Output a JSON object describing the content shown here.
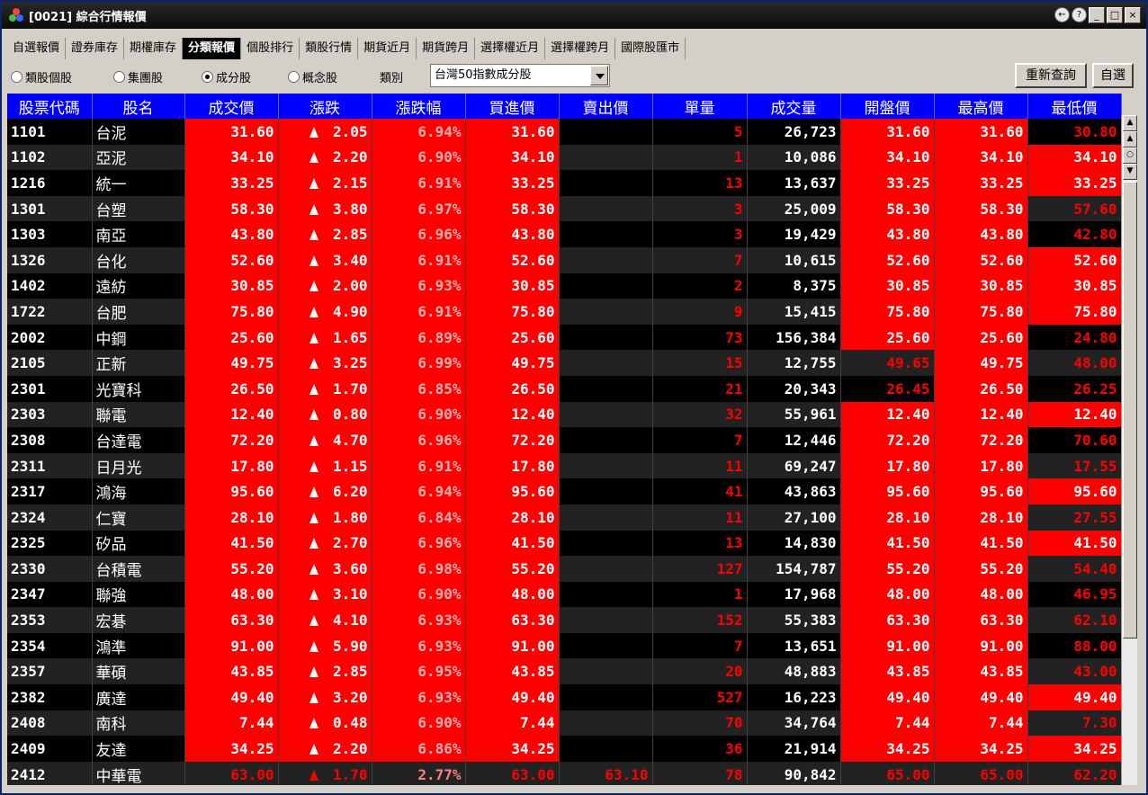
{
  "window": {
    "title": "[0021] 綜合行情報價",
    "help_label": "?",
    "minimize_label": "_",
    "maximize_label": "□",
    "close_label": "×",
    "back_label": "←"
  },
  "tabs": [
    "自選報價",
    "證券庫存",
    "期權庫存",
    "分類報價",
    "個股排行",
    "類股行情",
    "期貨近月",
    "期貨跨月",
    "選擇權近月",
    "選擇權跨月",
    "國際股匯市"
  ],
  "active_tab": "分類報價",
  "toolbar": {
    "radios": [
      "類股個股",
      "集團股",
      "成分股",
      "概念股"
    ],
    "selected_radio": "成分股",
    "category_label": "類別",
    "category_value": "台灣50指數成分股",
    "refresh_label": "重新查詢",
    "watchlist_label": "自選"
  },
  "columns": [
    "股票代碼",
    "股名",
    "成交價",
    "漲跌",
    "漲跌幅",
    "買進價",
    "賣出價",
    "單量",
    "成交量",
    "開盤價",
    "最高價",
    "最低價"
  ],
  "rows": [
    {
      "code": "1101",
      "name": "台泥",
      "price": "31.60",
      "chg": "2.05",
      "pct": "6.94%",
      "bid": "31.60",
      "ask": "",
      "qty": "5",
      "vol": "26,723",
      "open": "31.60",
      "high": "31.60",
      "low": "30.80"
    },
    {
      "code": "1102",
      "name": "亞泥",
      "price": "34.10",
      "chg": "2.20",
      "pct": "6.90%",
      "bid": "34.10",
      "ask": "",
      "qty": "1",
      "vol": "10,086",
      "open": "34.10",
      "high": "34.10",
      "low": "34.10"
    },
    {
      "code": "1216",
      "name": "統一",
      "price": "33.25",
      "chg": "2.15",
      "pct": "6.91%",
      "bid": "33.25",
      "ask": "",
      "qty": "13",
      "vol": "13,637",
      "open": "33.25",
      "high": "33.25",
      "low": "33.25"
    },
    {
      "code": "1301",
      "name": "台塑",
      "price": "58.30",
      "chg": "3.80",
      "pct": "6.97%",
      "bid": "58.30",
      "ask": "",
      "qty": "3",
      "vol": "25,009",
      "open": "58.30",
      "high": "58.30",
      "low": "57.60"
    },
    {
      "code": "1303",
      "name": "南亞",
      "price": "43.80",
      "chg": "2.85",
      "pct": "6.96%",
      "bid": "43.80",
      "ask": "",
      "qty": "3",
      "vol": "19,429",
      "open": "43.80",
      "high": "43.80",
      "low": "42.80"
    },
    {
      "code": "1326",
      "name": "台化",
      "price": "52.60",
      "chg": "3.40",
      "pct": "6.91%",
      "bid": "52.60",
      "ask": "",
      "qty": "7",
      "vol": "10,615",
      "open": "52.60",
      "high": "52.60",
      "low": "52.60"
    },
    {
      "code": "1402",
      "name": "遠紡",
      "price": "30.85",
      "chg": "2.00",
      "pct": "6.93%",
      "bid": "30.85",
      "ask": "",
      "qty": "2",
      "vol": "8,375",
      "open": "30.85",
      "high": "30.85",
      "low": "30.85"
    },
    {
      "code": "1722",
      "name": "台肥",
      "price": "75.80",
      "chg": "4.90",
      "pct": "6.91%",
      "bid": "75.80",
      "ask": "",
      "qty": "9",
      "vol": "15,415",
      "open": "75.80",
      "high": "75.80",
      "low": "75.80"
    },
    {
      "code": "2002",
      "name": "中鋼",
      "price": "25.60",
      "chg": "1.65",
      "pct": "6.89%",
      "bid": "25.60",
      "ask": "",
      "qty": "73",
      "vol": "156,384",
      "open": "25.60",
      "high": "25.60",
      "low": "24.80"
    },
    {
      "code": "2105",
      "name": "正新",
      "price": "49.75",
      "chg": "3.25",
      "pct": "6.99%",
      "bid": "49.75",
      "ask": "",
      "qty": "15",
      "vol": "12,755",
      "open": "49.65",
      "high": "49.75",
      "low": "48.00"
    },
    {
      "code": "2301",
      "name": "光寶科",
      "price": "26.50",
      "chg": "1.70",
      "pct": "6.85%",
      "bid": "26.50",
      "ask": "",
      "qty": "21",
      "vol": "20,343",
      "open": "26.45",
      "high": "26.50",
      "low": "26.25"
    },
    {
      "code": "2303",
      "name": "聯電",
      "price": "12.40",
      "chg": "0.80",
      "pct": "6.90%",
      "bid": "12.40",
      "ask": "",
      "qty": "32",
      "vol": "55,961",
      "open": "12.40",
      "high": "12.40",
      "low": "12.40"
    },
    {
      "code": "2308",
      "name": "台達電",
      "price": "72.20",
      "chg": "4.70",
      "pct": "6.96%",
      "bid": "72.20",
      "ask": "",
      "qty": "7",
      "vol": "12,446",
      "open": "72.20",
      "high": "72.20",
      "low": "70.60"
    },
    {
      "code": "2311",
      "name": "日月光",
      "price": "17.80",
      "chg": "1.15",
      "pct": "6.91%",
      "bid": "17.80",
      "ask": "",
      "qty": "11",
      "vol": "69,247",
      "open": "17.80",
      "high": "17.80",
      "low": "17.55"
    },
    {
      "code": "2317",
      "name": "鴻海",
      "price": "95.60",
      "chg": "6.20",
      "pct": "6.94%",
      "bid": "95.60",
      "ask": "",
      "qty": "41",
      "vol": "43,863",
      "open": "95.60",
      "high": "95.60",
      "low": "95.60"
    },
    {
      "code": "2324",
      "name": "仁寶",
      "price": "28.10",
      "chg": "1.80",
      "pct": "6.84%",
      "bid": "28.10",
      "ask": "",
      "qty": "11",
      "vol": "27,100",
      "open": "28.10",
      "high": "28.10",
      "low": "27.55"
    },
    {
      "code": "2325",
      "name": "矽品",
      "price": "41.50",
      "chg": "2.70",
      "pct": "6.96%",
      "bid": "41.50",
      "ask": "",
      "qty": "13",
      "vol": "14,830",
      "open": "41.50",
      "high": "41.50",
      "low": "41.50"
    },
    {
      "code": "2330",
      "name": "台積電",
      "price": "55.20",
      "chg": "3.60",
      "pct": "6.98%",
      "bid": "55.20",
      "ask": "",
      "qty": "127",
      "vol": "154,787",
      "open": "55.20",
      "high": "55.20",
      "low": "54.40"
    },
    {
      "code": "2347",
      "name": "聯強",
      "price": "48.00",
      "chg": "3.10",
      "pct": "6.90%",
      "bid": "48.00",
      "ask": "",
      "qty": "1",
      "vol": "17,968",
      "open": "48.00",
      "high": "48.00",
      "low": "46.95"
    },
    {
      "code": "2353",
      "name": "宏碁",
      "price": "63.30",
      "chg": "4.10",
      "pct": "6.93%",
      "bid": "63.30",
      "ask": "",
      "qty": "152",
      "vol": "55,383",
      "open": "63.30",
      "high": "63.30",
      "low": "62.10"
    },
    {
      "code": "2354",
      "name": "鴻準",
      "price": "91.00",
      "chg": "5.90",
      "pct": "6.93%",
      "bid": "91.00",
      "ask": "",
      "qty": "7",
      "vol": "13,651",
      "open": "91.00",
      "high": "91.00",
      "low": "88.00"
    },
    {
      "code": "2357",
      "name": "華碩",
      "price": "43.85",
      "chg": "2.85",
      "pct": "6.95%",
      "bid": "43.85",
      "ask": "",
      "qty": "20",
      "vol": "48,883",
      "open": "43.85",
      "high": "43.85",
      "low": "43.00"
    },
    {
      "code": "2382",
      "name": "廣達",
      "price": "49.40",
      "chg": "3.20",
      "pct": "6.93%",
      "bid": "49.40",
      "ask": "",
      "qty": "527",
      "vol": "16,223",
      "open": "49.40",
      "high": "49.40",
      "low": "49.40"
    },
    {
      "code": "2408",
      "name": "南科",
      "price": "7.44",
      "chg": "0.48",
      "pct": "6.90%",
      "bid": "7.44",
      "ask": "",
      "qty": "70",
      "vol": "34,764",
      "open": "7.44",
      "high": "7.44",
      "low": "7.30"
    },
    {
      "code": "2409",
      "name": "友達",
      "price": "34.25",
      "chg": "2.20",
      "pct": "6.86%",
      "bid": "34.25",
      "ask": "",
      "qty": "36",
      "vol": "21,914",
      "open": "34.25",
      "high": "34.25",
      "low": "34.25"
    },
    {
      "code": "2412",
      "name": "中華電",
      "price": "63.00",
      "chg": "1.70",
      "pct": "2.77%",
      "bid": "63.00",
      "ask": "63.10",
      "qty": "78",
      "vol": "90,842",
      "open": "65.00",
      "high": "65.00",
      "low": "62.20"
    }
  ],
  "colors": {
    "limit_up_bg": "#ff0000",
    "header_bg": "#0000ff",
    "up_text": "#ff0000",
    "row_bg": "#000000",
    "row_alt_bg": "#222222"
  }
}
